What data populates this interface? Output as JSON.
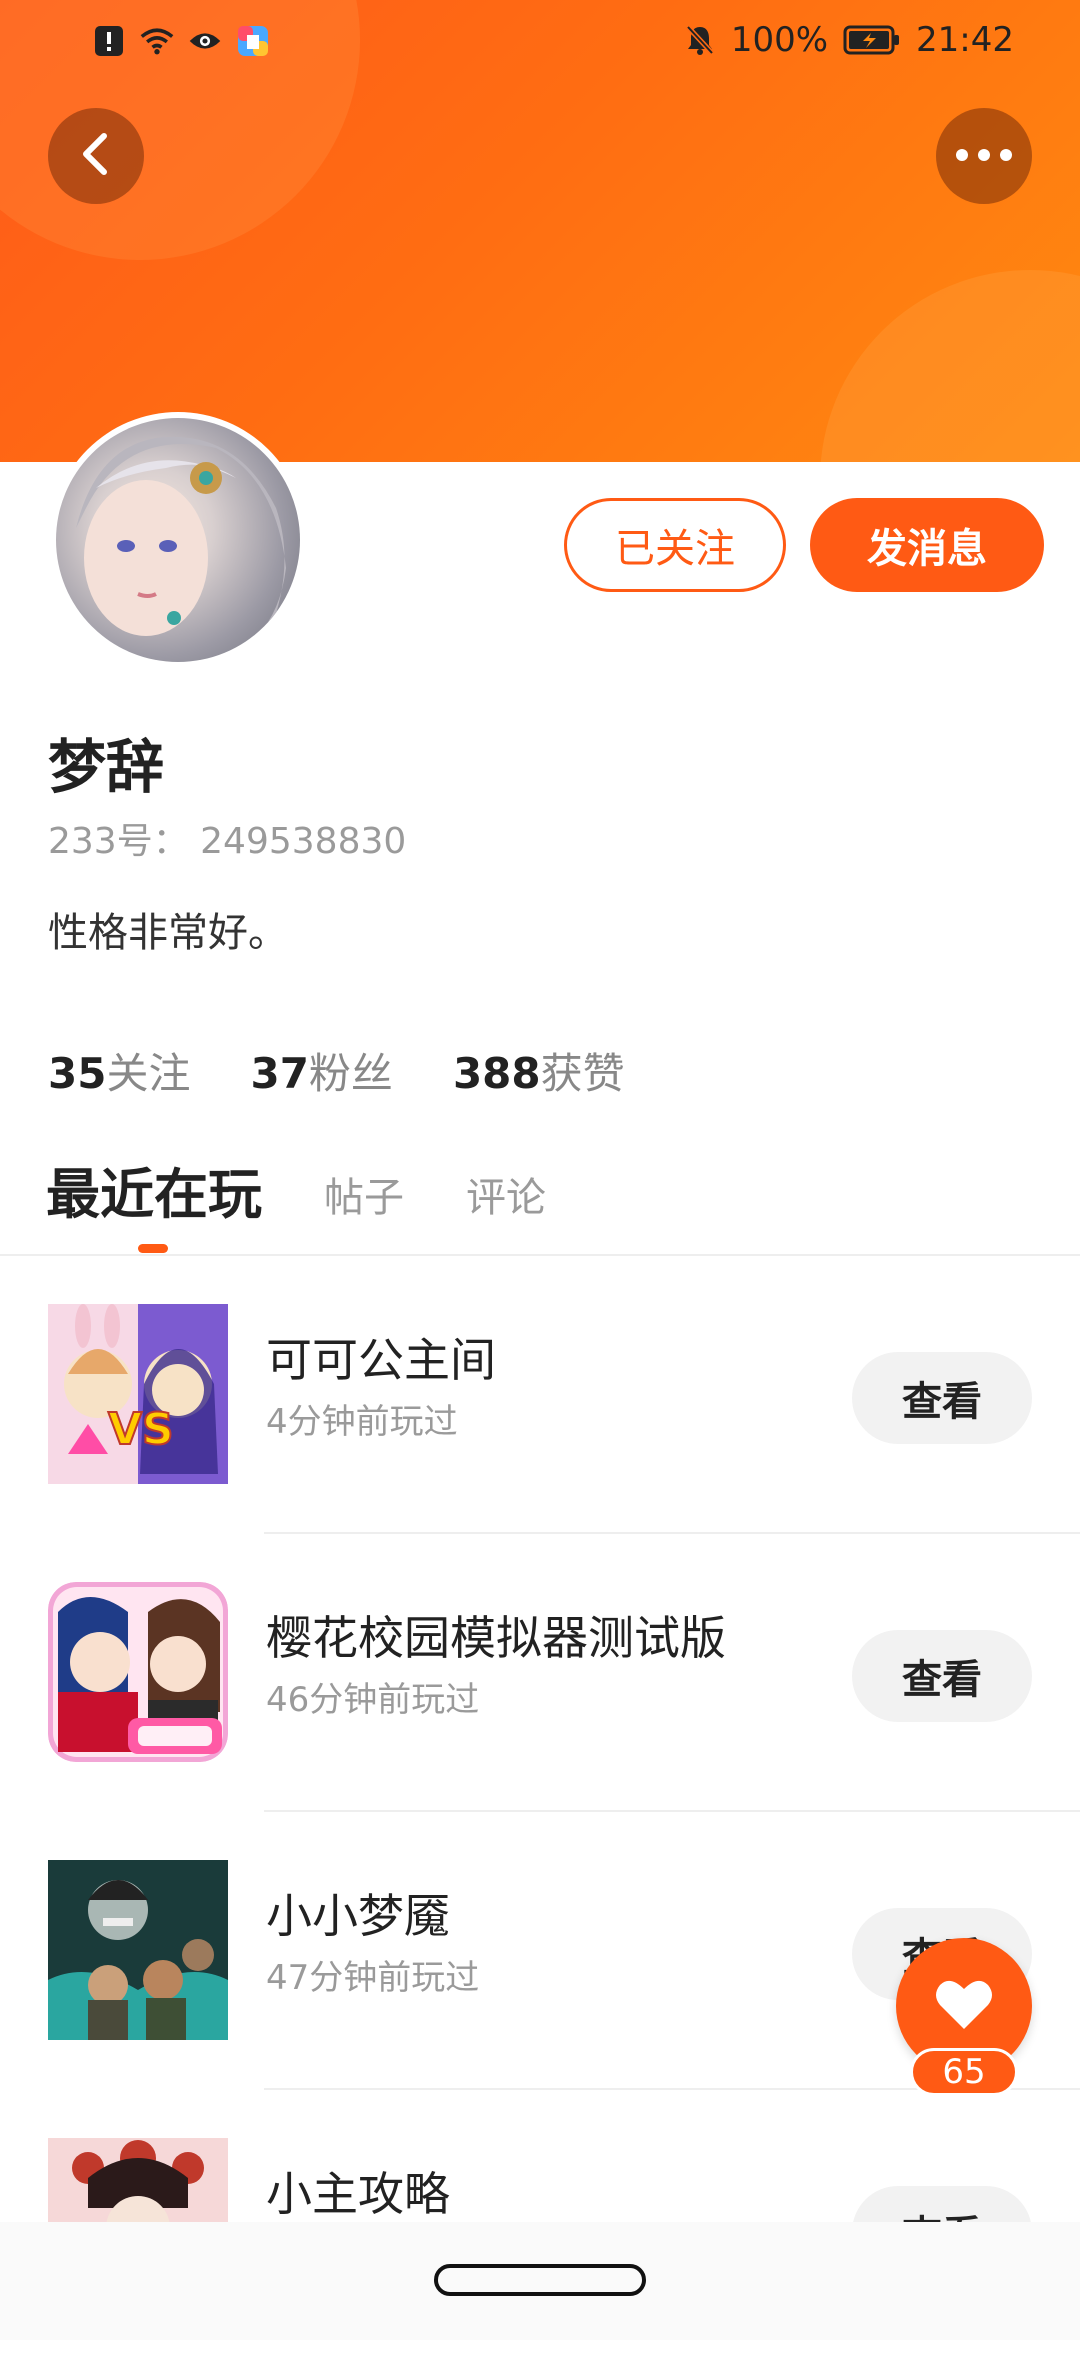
{
  "statusbar": {
    "battery_text": "100%",
    "time": "21:42"
  },
  "profile": {
    "name": "梦辞",
    "uid": "233号：  249538830",
    "bio": "性格非常好。",
    "follow_button": "已关注",
    "message_button": "发消息"
  },
  "stats": [
    {
      "num": "35",
      "label": "关注"
    },
    {
      "num": "37",
      "label": "粉丝"
    },
    {
      "num": "388",
      "label": "获赞"
    }
  ],
  "tabs": {
    "active": "最近在玩",
    "posts": "帖子",
    "comments": "评论"
  },
  "games": [
    {
      "name": "可可公主间",
      "time": "4分钟前玩过",
      "button": "查看"
    },
    {
      "name": "樱花校园模拟器测试版",
      "time": "46分钟前玩过",
      "button": "查看"
    },
    {
      "name": "小小梦魇",
      "time": "47分钟前玩过",
      "button": "查看"
    },
    {
      "name": "小主攻略",
      "time": "",
      "button": "查看"
    }
  ],
  "fab": {
    "count": "65"
  },
  "colors": {
    "accent": "#ff5a14",
    "banner_start": "#ff5a1a",
    "banner_end": "#ff8a10"
  },
  "icons": {
    "back": "back-arrow-icon",
    "more": "more-dots-icon",
    "like": "heart-icon"
  }
}
